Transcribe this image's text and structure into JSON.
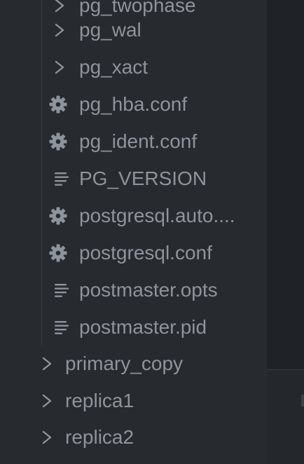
{
  "explorer": {
    "cut_item": {
      "label": "pg_twophase",
      "icon": "chevron-right-icon"
    },
    "children": [
      {
        "label": "pg_wal",
        "icon": "chevron-right-icon",
        "type": "folder"
      },
      {
        "label": "pg_xact",
        "icon": "chevron-right-icon",
        "type": "folder"
      },
      {
        "label": "pg_hba.conf",
        "icon": "gear-icon",
        "type": "settings-file"
      },
      {
        "label": "pg_ident.conf",
        "icon": "gear-icon",
        "type": "settings-file"
      },
      {
        "label": "PG_VERSION",
        "icon": "text-lines-icon",
        "type": "text-file"
      },
      {
        "label": "postgresql.auto....",
        "icon": "gear-icon",
        "type": "settings-file"
      },
      {
        "label": "postgresql.conf",
        "icon": "gear-icon",
        "type": "settings-file"
      },
      {
        "label": "postmaster.opts",
        "icon": "text-lines-icon",
        "type": "text-file"
      },
      {
        "label": "postmaster.pid",
        "icon": "text-lines-icon",
        "type": "text-file"
      }
    ],
    "parents": [
      {
        "label": "primary_copy",
        "icon": "chevron-right-icon",
        "type": "folder"
      },
      {
        "label": "replica1",
        "icon": "chevron-right-icon",
        "type": "folder"
      },
      {
        "label": "replica2",
        "icon": "chevron-right-icon",
        "type": "folder"
      }
    ]
  },
  "colors": {
    "sidebar_bg": "#272a2f",
    "editor_bg": "#1f2226",
    "text": "#8e949c",
    "icon": "#8e949c",
    "indent_guide": "#3b3f45"
  }
}
